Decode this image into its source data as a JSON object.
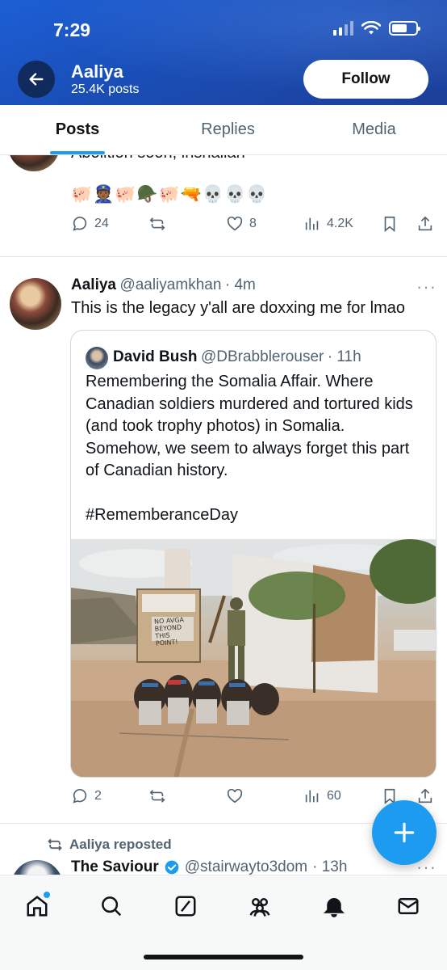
{
  "status": {
    "time": "7:29"
  },
  "header": {
    "name": "Aaliya",
    "post_count": "25.4K posts",
    "follow_label": "Follow"
  },
  "tabs": [
    {
      "label": "Posts",
      "active": true
    },
    {
      "label": "Replies",
      "active": false
    },
    {
      "label": "Media",
      "active": false
    }
  ],
  "post1": {
    "partial_text": "Abolition soon, inshallah",
    "emoji_line": "🐖👮🏾🐖🪖🐖🔫💀💀💀",
    "replies": "24",
    "likes": "8",
    "views": "4.2K"
  },
  "post2": {
    "name": "Aaliya",
    "handle": "@aaliyamkhan",
    "time": "· 4m",
    "text": "This is the legacy y'all are doxxing me for lmao",
    "quote": {
      "name": "David Bush",
      "handle": "@DBrabblerouser",
      "time": "· 11h",
      "text": "Remembering the Somalia Affair. Where Canadian soldiers murdered and tortured kids (and took trophy photos) in Somalia. Somehow, we seem to always forget this part of Canadian history.\n\n#RememberanceDay",
      "sign_text": "NO AVGA BEYOND THIS POINT!"
    },
    "replies": "2",
    "views": "60"
  },
  "post3": {
    "repost_label": "Aaliya reposted",
    "name": "The Saviour",
    "handle": "@stairwayto3dom",
    "time": "· 13h"
  },
  "colors": {
    "accent": "#1d9bf0",
    "header_blue": "#1a4fb8",
    "muted": "#536471"
  }
}
